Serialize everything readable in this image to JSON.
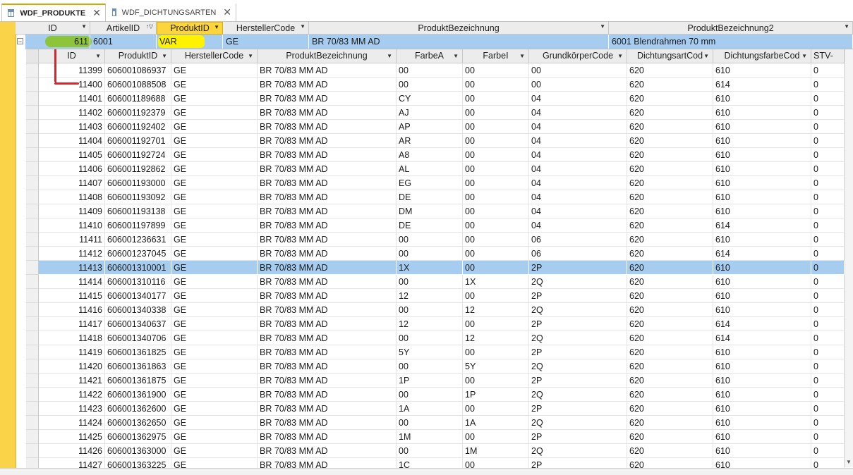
{
  "tabs": [
    {
      "label": "WDF_PRODUKTE",
      "active": true
    },
    {
      "label": "WDF_DICHTUNGSARTEN",
      "active": false
    }
  ],
  "outer": {
    "headers": [
      "ID",
      "ArtikelID",
      "ProduktID",
      "HerstellerCode",
      "ProduktBezeichnung",
      "ProduktBezeichnung2"
    ],
    "row": {
      "id": "611",
      "artikel": "6001",
      "produkt": "VAR",
      "hersteller": "GE",
      "bez": "BR 70/83 MM AD",
      "bez2": "6001 Blendrahmen 70 mm"
    }
  },
  "sub": {
    "headers": [
      "ID",
      "ProduktID",
      "HerstellerCode",
      "ProduktBezeichnung",
      "FarbeA",
      "FarbeI",
      "GrundkörperCode",
      "DichtungsartCod",
      "DichtungsfarbeCod",
      "STV-"
    ],
    "rows": [
      [
        "11399",
        "606001086937",
        "GE",
        "BR 70/83 MM AD",
        "00",
        "00",
        "00",
        "620",
        "610",
        "0"
      ],
      [
        "11400",
        "606001088508",
        "GE",
        "BR 70/83 MM AD",
        "00",
        "00",
        "00",
        "620",
        "614",
        "0"
      ],
      [
        "11401",
        "606001189688",
        "GE",
        "BR 70/83 MM AD",
        "CY",
        "00",
        "04",
        "620",
        "610",
        "0"
      ],
      [
        "11402",
        "606001192379",
        "GE",
        "BR 70/83 MM AD",
        "AJ",
        "00",
        "04",
        "620",
        "610",
        "0"
      ],
      [
        "11403",
        "606001192402",
        "GE",
        "BR 70/83 MM AD",
        "AP",
        "00",
        "04",
        "620",
        "610",
        "0"
      ],
      [
        "11404",
        "606001192701",
        "GE",
        "BR 70/83 MM AD",
        "AR",
        "00",
        "04",
        "620",
        "610",
        "0"
      ],
      [
        "11405",
        "606001192724",
        "GE",
        "BR 70/83 MM AD",
        "A8",
        "00",
        "04",
        "620",
        "610",
        "0"
      ],
      [
        "11406",
        "606001192862",
        "GE",
        "BR 70/83 MM AD",
        "AL",
        "00",
        "04",
        "620",
        "610",
        "0"
      ],
      [
        "11407",
        "606001193000",
        "GE",
        "BR 70/83 MM AD",
        "EG",
        "00",
        "04",
        "620",
        "610",
        "0"
      ],
      [
        "11408",
        "606001193092",
        "GE",
        "BR 70/83 MM AD",
        "DE",
        "00",
        "04",
        "620",
        "610",
        "0"
      ],
      [
        "11409",
        "606001193138",
        "GE",
        "BR 70/83 MM AD",
        "DM",
        "00",
        "04",
        "620",
        "610",
        "0"
      ],
      [
        "11410",
        "606001197899",
        "GE",
        "BR 70/83 MM AD",
        "DE",
        "00",
        "04",
        "620",
        "614",
        "0"
      ],
      [
        "11411",
        "606001236631",
        "GE",
        "BR 70/83 MM AD",
        "00",
        "00",
        "06",
        "620",
        "610",
        "0"
      ],
      [
        "11412",
        "606001237045",
        "GE",
        "BR 70/83 MM AD",
        "00",
        "00",
        "06",
        "620",
        "614",
        "0"
      ],
      [
        "11413",
        "606001310001",
        "GE",
        "BR 70/83 MM AD",
        "1X",
        "00",
        "2P",
        "620",
        "610",
        "0"
      ],
      [
        "11414",
        "606001310116",
        "GE",
        "BR 70/83 MM AD",
        "00",
        "1X",
        "2Q",
        "620",
        "610",
        "0"
      ],
      [
        "11415",
        "606001340177",
        "GE",
        "BR 70/83 MM AD",
        "12",
        "00",
        "2P",
        "620",
        "610",
        "0"
      ],
      [
        "11416",
        "606001340338",
        "GE",
        "BR 70/83 MM AD",
        "00",
        "12",
        "2Q",
        "620",
        "610",
        "0"
      ],
      [
        "11417",
        "606001340637",
        "GE",
        "BR 70/83 MM AD",
        "12",
        "00",
        "2P",
        "620",
        "614",
        "0"
      ],
      [
        "11418",
        "606001340706",
        "GE",
        "BR 70/83 MM AD",
        "00",
        "12",
        "2Q",
        "620",
        "614",
        "0"
      ],
      [
        "11419",
        "606001361825",
        "GE",
        "BR 70/83 MM AD",
        "5Y",
        "00",
        "2P",
        "620",
        "610",
        "0"
      ],
      [
        "11420",
        "606001361863",
        "GE",
        "BR 70/83 MM AD",
        "00",
        "5Y",
        "2Q",
        "620",
        "610",
        "0"
      ],
      [
        "11421",
        "606001361875",
        "GE",
        "BR 70/83 MM AD",
        "1P",
        "00",
        "2P",
        "620",
        "610",
        "0"
      ],
      [
        "11422",
        "606001361900",
        "GE",
        "BR 70/83 MM AD",
        "00",
        "1P",
        "2Q",
        "620",
        "610",
        "0"
      ],
      [
        "11423",
        "606001362600",
        "GE",
        "BR 70/83 MM AD",
        "1A",
        "00",
        "2P",
        "620",
        "610",
        "0"
      ],
      [
        "11424",
        "606001362650",
        "GE",
        "BR 70/83 MM AD",
        "00",
        "1A",
        "2Q",
        "620",
        "610",
        "0"
      ],
      [
        "11425",
        "606001362975",
        "GE",
        "BR 70/83 MM AD",
        "1M",
        "00",
        "2P",
        "620",
        "610",
        "0"
      ],
      [
        "11426",
        "606001363000",
        "GE",
        "BR 70/83 MM AD",
        "00",
        "1M",
        "2Q",
        "620",
        "610",
        "0"
      ],
      [
        "11427",
        "606001363225",
        "GE",
        "BR 70/83 MM AD",
        "1C",
        "00",
        "2P",
        "620",
        "610",
        "0"
      ]
    ],
    "highlight_row": 14
  },
  "colors": {
    "highlight": "#a6cdf0",
    "accent_yellow": "#fbd348",
    "annot_red": "#d8252c",
    "annot_green": "#8cc43a",
    "annot_yellow": "#fff200"
  }
}
